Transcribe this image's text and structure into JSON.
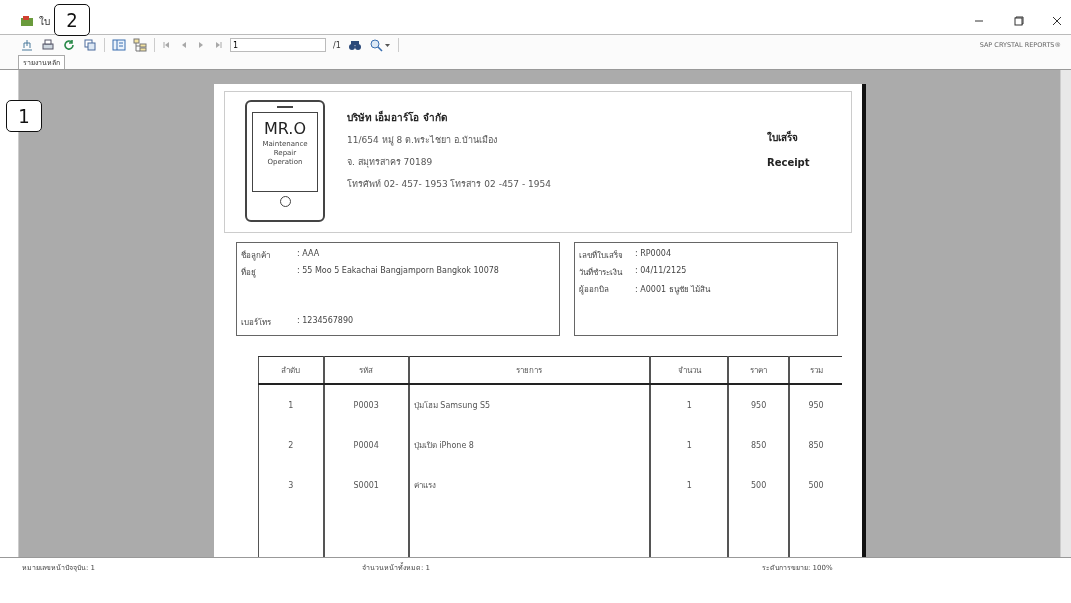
{
  "window": {
    "title": "ใบ"
  },
  "callouts": [
    {
      "label": "1"
    },
    {
      "label": "2"
    }
  ],
  "toolbar": {
    "buttons": [
      {
        "kind": "export",
        "disabled": false
      },
      {
        "kind": "print",
        "disabled": false
      },
      {
        "kind": "refresh",
        "disabled": false
      },
      {
        "kind": "copy",
        "disabled": false
      },
      {
        "kind": "tree",
        "disabled": false
      },
      {
        "kind": "panel",
        "disabled": false
      },
      {
        "kind": "first",
        "disabled": true
      },
      {
        "kind": "prev",
        "disabled": true
      },
      {
        "kind": "next",
        "disabled": true
      },
      {
        "kind": "last",
        "disabled": true
      }
    ],
    "page_field": "1",
    "page_total": "/1",
    "brand": "SAP CRYSTAL REPORTS®"
  },
  "tabs": [
    {
      "label": "รายงานหลัก",
      "selected": true
    }
  ],
  "report": {
    "logo": {
      "title": "MR.O",
      "subtitle": [
        "Maintenance",
        "Repair",
        "Operation"
      ]
    },
    "company": {
      "name": "บริษัท เอ็มอาร์โอ จำกัด",
      "lines": [
        "11/654 หมู่ 8 ต.พระไชยา อ.บ้านเมือง",
        "จ. สมุทรสาคร 70189",
        "โทรศัพท์ 02- 457- 1953 โทรสาร 02 -457 - 1954"
      ]
    },
    "doc_title": {
      "thai": "ใบเสร็จ",
      "english": "Receipt"
    },
    "customer": [
      {
        "label": "ชื่อลูกค้า",
        "value": ": AAA"
      },
      {
        "label": "ที่อยู่",
        "value": ": 55 Moo 5 Eakachai Bangjamporn Bangkok 10078"
      },
      {
        "label": "เบอร์โทร",
        "value": ": 1234567890"
      }
    ],
    "invoice": [
      {
        "label": "เลขที่ใบเสร็จ",
        "value": ": RP0004"
      },
      {
        "label": "วันที่ชำระเงิน",
        "value": ": 04/11/2125"
      },
      {
        "label": "ผู้ออกบิล",
        "value": ": A0001 ธนูชัย ไม้สิน"
      }
    ],
    "table": {
      "columns": [
        "ลำดับ",
        "รหัส",
        "รายการ",
        "จำนวน",
        "ราคา",
        "รวม"
      ],
      "rows": [
        [
          "1",
          "P0003",
          "ปุ่มโฮม Samsung S5",
          "1",
          "950",
          "950"
        ],
        [
          "2",
          "P0004",
          "ปุ่มเปิด iPhone 8",
          "1",
          "850",
          "850"
        ],
        [
          "3",
          "S0001",
          "ค่าแรง",
          "1",
          "500",
          "500"
        ]
      ]
    }
  },
  "status_bar": [
    "หมายเลขหน้าปัจจุบัน: 1",
    "จำนวนหน้าทั้งหมด: 1",
    "ระดับการขยาย: 100%"
  ]
}
